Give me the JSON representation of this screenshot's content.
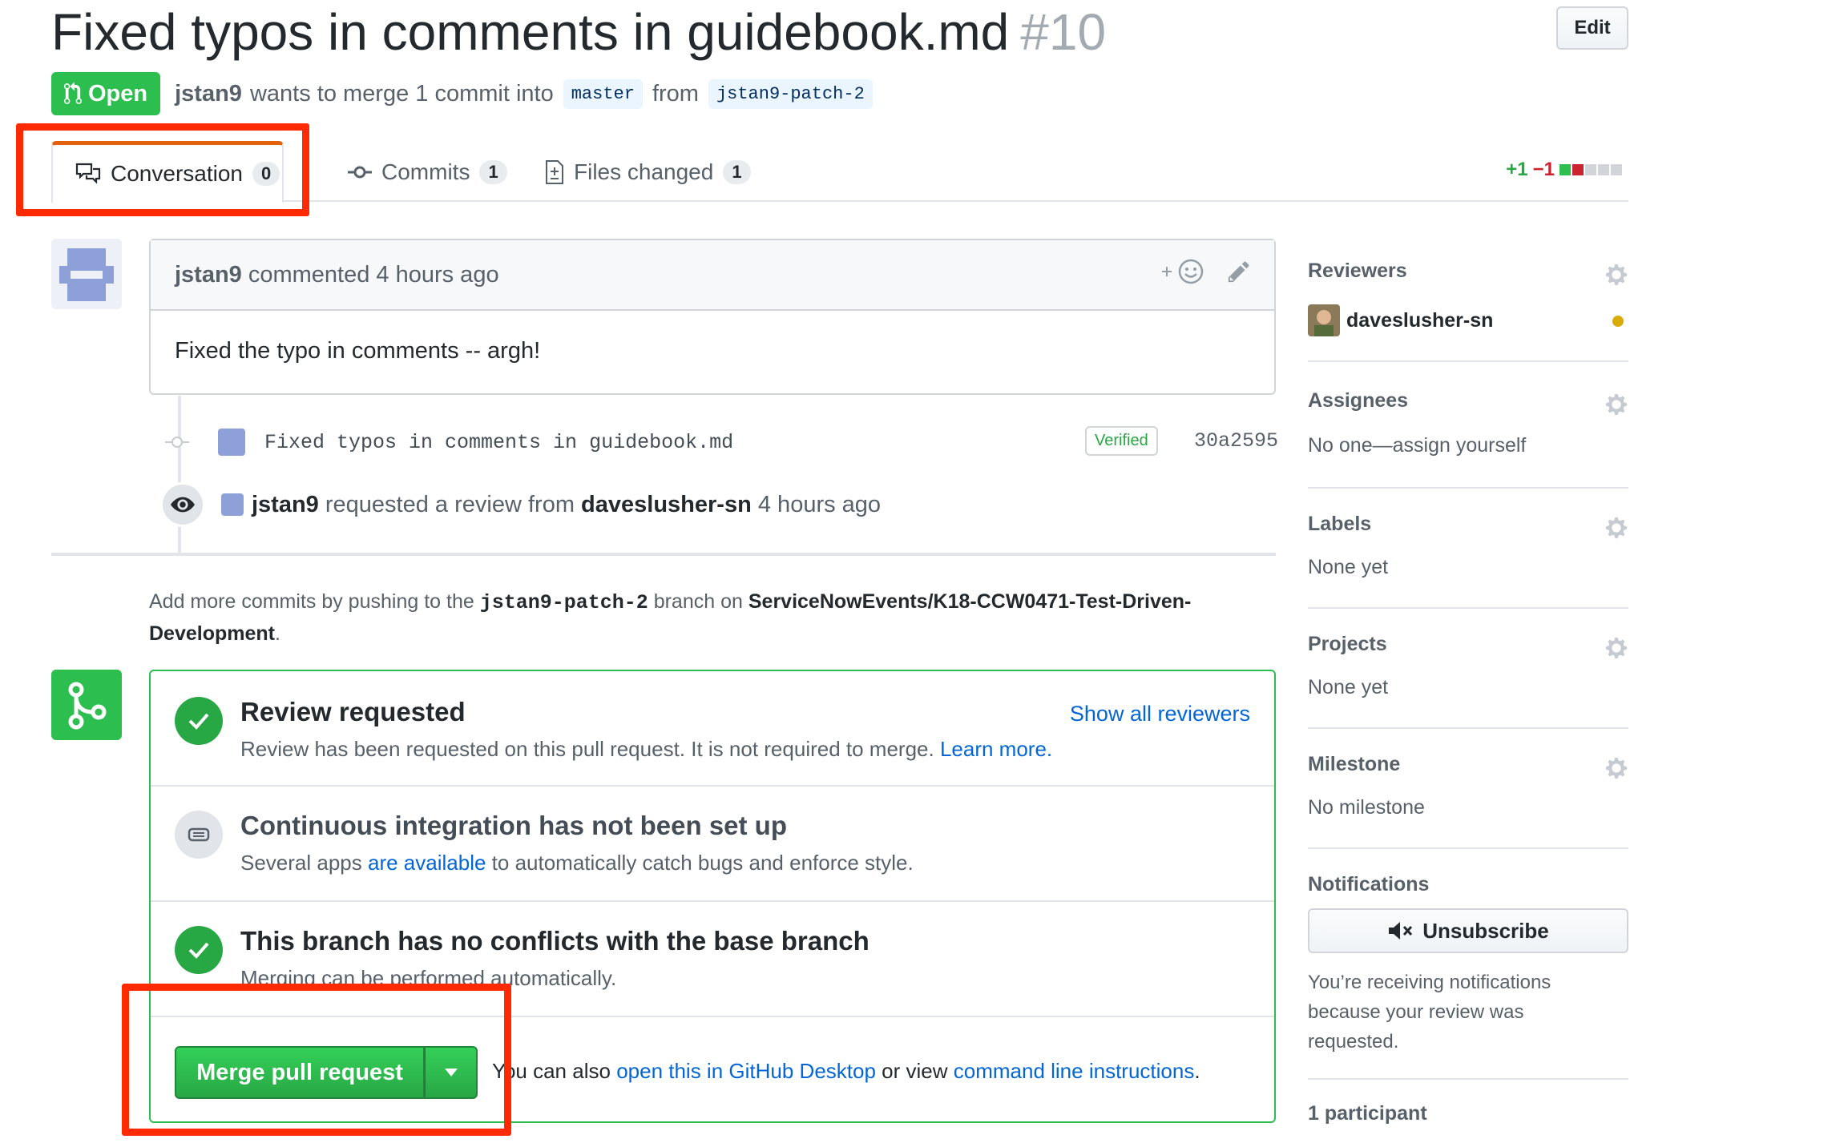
{
  "pr": {
    "title": "Fixed typos in comments in guidebook.md",
    "number": "#10",
    "edit_label": "Edit",
    "state": "Open",
    "author": "jstan9",
    "merge_text_1": "wants to merge 1 commit into",
    "base_branch": "master",
    "from_text": "from",
    "head_branch": "jstan9-patch-2"
  },
  "tabs": [
    {
      "label": "Conversation",
      "count": "0"
    },
    {
      "label": "Commits",
      "count": "1"
    },
    {
      "label": "Files changed",
      "count": "1"
    }
  ],
  "diffstat": {
    "additions": "+1",
    "deletions": "−1"
  },
  "comment": {
    "author": "jstan9",
    "action": "commented 4 hours ago",
    "body": "Fixed the typo in comments -- argh!"
  },
  "commit": {
    "message": "Fixed typos in comments in guidebook.md",
    "verified": "Verified",
    "sha": "30a2595"
  },
  "review_event": {
    "actor": "jstan9",
    "text": "requested a review from",
    "reviewer": "daveslusher-sn",
    "time": "4 hours ago"
  },
  "push_hint": {
    "prefix": "Add more commits by pushing to the",
    "branch": "jstan9-patch-2",
    "middle": "branch on",
    "repo": "ServiceNowEvents/K18-CCW0471-Test-Driven-Development",
    "suffix": "."
  },
  "merge_box": {
    "review_title": "Review requested",
    "review_sub": "Review has been requested on this pull request. It is not required to merge.",
    "learn_more": "Learn more.",
    "show_reviewers": "Show all reviewers",
    "ci_title": "Continuous integration has not been set up",
    "ci_sub_prefix": "Several apps",
    "ci_link": "are available",
    "ci_sub_suffix": "to automatically catch bugs and enforce style.",
    "conflict_title": "This branch has no conflicts with the base branch",
    "conflict_sub": "Merging can be performed automatically.",
    "merge_button": "Merge pull request",
    "alt_prefix": "You can also",
    "alt_link_1": "open this in GitHub Desktop",
    "alt_mid": "or view",
    "alt_link_2": "command line instructions",
    "alt_suffix": "."
  },
  "sidebar": {
    "reviewers": {
      "heading": "Reviewers",
      "user": "daveslusher-sn"
    },
    "assignees": {
      "heading": "Assignees",
      "value": "No one—assign yourself"
    },
    "labels": {
      "heading": "Labels",
      "value": "None yet"
    },
    "projects": {
      "heading": "Projects",
      "value": "None yet"
    },
    "milestone": {
      "heading": "Milestone",
      "value": "No milestone"
    },
    "notifications": {
      "heading": "Notifications",
      "button": "Unsubscribe",
      "line1": "You’re receiving notifications",
      "line2": "because your review was",
      "line3": "requested."
    },
    "participants": "1 participant"
  },
  "colors": {
    "open_green": "#2cbe4e",
    "link_blue": "#0366d6",
    "annotation_red": "#ff2a00",
    "pending_dot": "#dbab09"
  }
}
